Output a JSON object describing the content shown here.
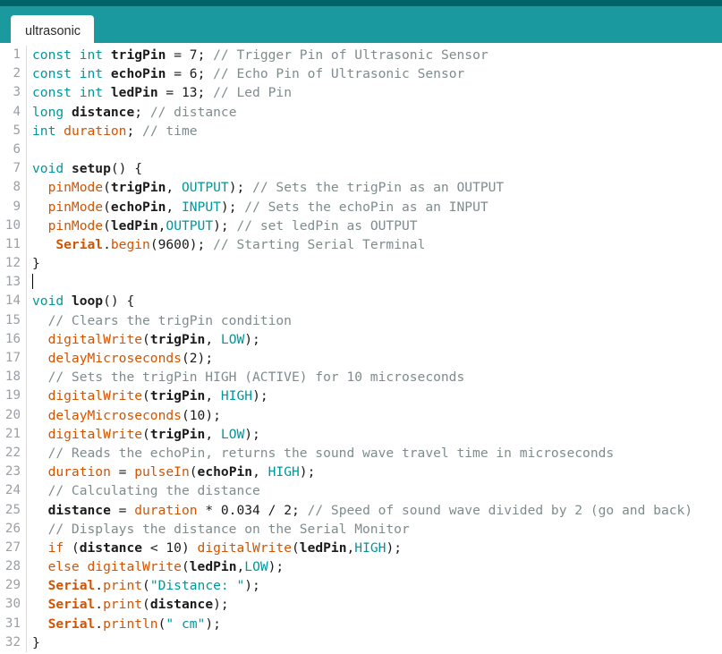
{
  "window": {
    "accent_color": "#1a9a9e",
    "accent_dark_color": "#006468",
    "background_color": "#ffffff"
  },
  "tabs": [
    {
      "label": "ultrasonic",
      "active": true
    }
  ],
  "editor": {
    "language": "arduino",
    "cursor_line": 13,
    "total_lines": 32,
    "colors": {
      "keyword": "#00979c",
      "function": "#d35400",
      "variable": "#d35400",
      "comment": "#7e8c8d",
      "string": "#00979c",
      "identifier": "#1b1b1b",
      "gutter_text": "#9aa0a6"
    },
    "lines": [
      {
        "n": "1",
        "tokens": [
          {
            "t": "kw",
            "v": "const"
          },
          {
            "t": "plain",
            "v": " "
          },
          {
            "t": "kw",
            "v": "int"
          },
          {
            "t": "plain",
            "v": " "
          },
          {
            "t": "id",
            "v": "trigPin"
          },
          {
            "t": "plain",
            "v": " = "
          },
          {
            "t": "num",
            "v": "7"
          },
          {
            "t": "plain",
            "v": "; "
          },
          {
            "t": "com",
            "v": "// Trigger Pin of Ultrasonic Sensor"
          }
        ]
      },
      {
        "n": "2",
        "tokens": [
          {
            "t": "kw",
            "v": "const"
          },
          {
            "t": "plain",
            "v": " "
          },
          {
            "t": "kw",
            "v": "int"
          },
          {
            "t": "plain",
            "v": " "
          },
          {
            "t": "id",
            "v": "echoPin"
          },
          {
            "t": "plain",
            "v": " = "
          },
          {
            "t": "num",
            "v": "6"
          },
          {
            "t": "plain",
            "v": "; "
          },
          {
            "t": "com",
            "v": "// Echo Pin of Ultrasonic Sensor"
          }
        ]
      },
      {
        "n": "3",
        "tokens": [
          {
            "t": "kw",
            "v": "const"
          },
          {
            "t": "plain",
            "v": " "
          },
          {
            "t": "kw",
            "v": "int"
          },
          {
            "t": "plain",
            "v": " "
          },
          {
            "t": "id",
            "v": "ledPin"
          },
          {
            "t": "plain",
            "v": " = "
          },
          {
            "t": "num",
            "v": "13"
          },
          {
            "t": "plain",
            "v": "; "
          },
          {
            "t": "com",
            "v": "// Led Pin"
          }
        ]
      },
      {
        "n": "4",
        "tokens": [
          {
            "t": "kw",
            "v": "long"
          },
          {
            "t": "plain",
            "v": " "
          },
          {
            "t": "id",
            "v": "distance"
          },
          {
            "t": "plain",
            "v": "; "
          },
          {
            "t": "com",
            "v": "// distance"
          }
        ]
      },
      {
        "n": "5",
        "tokens": [
          {
            "t": "kw",
            "v": "int"
          },
          {
            "t": "plain",
            "v": " "
          },
          {
            "t": "var",
            "v": "duration"
          },
          {
            "t": "plain",
            "v": "; "
          },
          {
            "t": "com",
            "v": "// time"
          }
        ]
      },
      {
        "n": "6",
        "tokens": []
      },
      {
        "n": "7",
        "tokens": [
          {
            "t": "kw",
            "v": "void"
          },
          {
            "t": "plain",
            "v": " "
          },
          {
            "t": "id",
            "v": "setup"
          },
          {
            "t": "plain",
            "v": "() {"
          }
        ]
      },
      {
        "n": "8",
        "tokens": [
          {
            "t": "plain",
            "v": "  "
          },
          {
            "t": "fn",
            "v": "pinMode"
          },
          {
            "t": "plain",
            "v": "("
          },
          {
            "t": "id",
            "v": "trigPin"
          },
          {
            "t": "plain",
            "v": ", "
          },
          {
            "t": "const",
            "v": "OUTPUT"
          },
          {
            "t": "plain",
            "v": "); "
          },
          {
            "t": "com",
            "v": "// Sets the trigPin as an OUTPUT"
          }
        ]
      },
      {
        "n": "9",
        "tokens": [
          {
            "t": "plain",
            "v": "  "
          },
          {
            "t": "fn",
            "v": "pinMode"
          },
          {
            "t": "plain",
            "v": "("
          },
          {
            "t": "id",
            "v": "echoPin"
          },
          {
            "t": "plain",
            "v": ", "
          },
          {
            "t": "const",
            "v": "INPUT"
          },
          {
            "t": "plain",
            "v": "); "
          },
          {
            "t": "com",
            "v": "// Sets the echoPin as an INPUT"
          }
        ]
      },
      {
        "n": "10",
        "tokens": [
          {
            "t": "plain",
            "v": "  "
          },
          {
            "t": "fn",
            "v": "pinMode"
          },
          {
            "t": "plain",
            "v": "("
          },
          {
            "t": "id",
            "v": "ledPin"
          },
          {
            "t": "plain",
            "v": ","
          },
          {
            "t": "const",
            "v": "OUTPUT"
          },
          {
            "t": "plain",
            "v": "); "
          },
          {
            "t": "com",
            "v": "// set ledPin as OUTPUT"
          }
        ]
      },
      {
        "n": "11",
        "tokens": [
          {
            "t": "plain",
            "v": "   "
          },
          {
            "t": "obj",
            "v": "Serial"
          },
          {
            "t": "plain",
            "v": "."
          },
          {
            "t": "fn",
            "v": "begin"
          },
          {
            "t": "plain",
            "v": "("
          },
          {
            "t": "num",
            "v": "9600"
          },
          {
            "t": "plain",
            "v": "); "
          },
          {
            "t": "com",
            "v": "// Starting Serial Terminal"
          }
        ]
      },
      {
        "n": "12",
        "tokens": [
          {
            "t": "plain",
            "v": "}"
          }
        ]
      },
      {
        "n": "13",
        "tokens": [],
        "cursor": true
      },
      {
        "n": "14",
        "tokens": [
          {
            "t": "kw",
            "v": "void"
          },
          {
            "t": "plain",
            "v": " "
          },
          {
            "t": "id",
            "v": "loop"
          },
          {
            "t": "plain",
            "v": "() {"
          }
        ]
      },
      {
        "n": "15",
        "tokens": [
          {
            "t": "plain",
            "v": "  "
          },
          {
            "t": "com",
            "v": "// Clears the trigPin condition"
          }
        ]
      },
      {
        "n": "16",
        "tokens": [
          {
            "t": "plain",
            "v": "  "
          },
          {
            "t": "fn",
            "v": "digitalWrite"
          },
          {
            "t": "plain",
            "v": "("
          },
          {
            "t": "id",
            "v": "trigPin"
          },
          {
            "t": "plain",
            "v": ", "
          },
          {
            "t": "const",
            "v": "LOW"
          },
          {
            "t": "plain",
            "v": ");"
          }
        ]
      },
      {
        "n": "17",
        "tokens": [
          {
            "t": "plain",
            "v": "  "
          },
          {
            "t": "fn",
            "v": "delayMicroseconds"
          },
          {
            "t": "plain",
            "v": "("
          },
          {
            "t": "num",
            "v": "2"
          },
          {
            "t": "plain",
            "v": ");"
          }
        ]
      },
      {
        "n": "18",
        "tokens": [
          {
            "t": "plain",
            "v": "  "
          },
          {
            "t": "com",
            "v": "// Sets the trigPin HIGH (ACTIVE) for 10 microseconds"
          }
        ]
      },
      {
        "n": "19",
        "tokens": [
          {
            "t": "plain",
            "v": "  "
          },
          {
            "t": "fn",
            "v": "digitalWrite"
          },
          {
            "t": "plain",
            "v": "("
          },
          {
            "t": "id",
            "v": "trigPin"
          },
          {
            "t": "plain",
            "v": ", "
          },
          {
            "t": "const",
            "v": "HIGH"
          },
          {
            "t": "plain",
            "v": ");"
          }
        ]
      },
      {
        "n": "20",
        "tokens": [
          {
            "t": "plain",
            "v": "  "
          },
          {
            "t": "fn",
            "v": "delayMicroseconds"
          },
          {
            "t": "plain",
            "v": "("
          },
          {
            "t": "num",
            "v": "10"
          },
          {
            "t": "plain",
            "v": ");"
          }
        ]
      },
      {
        "n": "21",
        "tokens": [
          {
            "t": "plain",
            "v": "  "
          },
          {
            "t": "fn",
            "v": "digitalWrite"
          },
          {
            "t": "plain",
            "v": "("
          },
          {
            "t": "id",
            "v": "trigPin"
          },
          {
            "t": "plain",
            "v": ", "
          },
          {
            "t": "const",
            "v": "LOW"
          },
          {
            "t": "plain",
            "v": ");"
          }
        ]
      },
      {
        "n": "22",
        "tokens": [
          {
            "t": "plain",
            "v": "  "
          },
          {
            "t": "com",
            "v": "// Reads the echoPin, returns the sound wave travel time in microseconds"
          }
        ]
      },
      {
        "n": "23",
        "tokens": [
          {
            "t": "plain",
            "v": "  "
          },
          {
            "t": "var",
            "v": "duration"
          },
          {
            "t": "plain",
            "v": " = "
          },
          {
            "t": "fn",
            "v": "pulseIn"
          },
          {
            "t": "plain",
            "v": "("
          },
          {
            "t": "id",
            "v": "echoPin"
          },
          {
            "t": "plain",
            "v": ", "
          },
          {
            "t": "const",
            "v": "HIGH"
          },
          {
            "t": "plain",
            "v": ");"
          }
        ]
      },
      {
        "n": "24",
        "tokens": [
          {
            "t": "plain",
            "v": "  "
          },
          {
            "t": "com",
            "v": "// Calculating the distance"
          }
        ]
      },
      {
        "n": "25",
        "tokens": [
          {
            "t": "plain",
            "v": "  "
          },
          {
            "t": "id",
            "v": "distance"
          },
          {
            "t": "plain",
            "v": " = "
          },
          {
            "t": "var",
            "v": "duration"
          },
          {
            "t": "plain",
            "v": " * "
          },
          {
            "t": "num",
            "v": "0.034"
          },
          {
            "t": "plain",
            "v": " / "
          },
          {
            "t": "num",
            "v": "2"
          },
          {
            "t": "plain",
            "v": "; "
          },
          {
            "t": "com",
            "v": "// Speed of sound wave divided by 2 (go and back)"
          }
        ]
      },
      {
        "n": "26",
        "tokens": [
          {
            "t": "plain",
            "v": "  "
          },
          {
            "t": "com",
            "v": "// Displays the distance on the Serial Monitor"
          }
        ]
      },
      {
        "n": "27",
        "tokens": [
          {
            "t": "plain",
            "v": "  "
          },
          {
            "t": "fn",
            "v": "if"
          },
          {
            "t": "plain",
            "v": " ("
          },
          {
            "t": "id",
            "v": "distance"
          },
          {
            "t": "plain",
            "v": " < "
          },
          {
            "t": "num",
            "v": "10"
          },
          {
            "t": "plain",
            "v": ") "
          },
          {
            "t": "fn",
            "v": "digitalWrite"
          },
          {
            "t": "plain",
            "v": "("
          },
          {
            "t": "id",
            "v": "ledPin"
          },
          {
            "t": "plain",
            "v": ","
          },
          {
            "t": "const",
            "v": "HIGH"
          },
          {
            "t": "plain",
            "v": ");"
          }
        ]
      },
      {
        "n": "28",
        "tokens": [
          {
            "t": "plain",
            "v": "  "
          },
          {
            "t": "fn",
            "v": "else"
          },
          {
            "t": "plain",
            "v": " "
          },
          {
            "t": "fn",
            "v": "digitalWrite"
          },
          {
            "t": "plain",
            "v": "("
          },
          {
            "t": "id",
            "v": "ledPin"
          },
          {
            "t": "plain",
            "v": ","
          },
          {
            "t": "const",
            "v": "LOW"
          },
          {
            "t": "plain",
            "v": ");"
          }
        ]
      },
      {
        "n": "29",
        "tokens": [
          {
            "t": "plain",
            "v": "  "
          },
          {
            "t": "obj",
            "v": "Serial"
          },
          {
            "t": "plain",
            "v": "."
          },
          {
            "t": "fn",
            "v": "print"
          },
          {
            "t": "plain",
            "v": "("
          },
          {
            "t": "str",
            "v": "\"Distance: \""
          },
          {
            "t": "plain",
            "v": ");"
          }
        ]
      },
      {
        "n": "30",
        "tokens": [
          {
            "t": "plain",
            "v": "  "
          },
          {
            "t": "obj",
            "v": "Serial"
          },
          {
            "t": "plain",
            "v": "."
          },
          {
            "t": "fn",
            "v": "print"
          },
          {
            "t": "plain",
            "v": "("
          },
          {
            "t": "id",
            "v": "distance"
          },
          {
            "t": "plain",
            "v": ");"
          }
        ]
      },
      {
        "n": "31",
        "tokens": [
          {
            "t": "plain",
            "v": "  "
          },
          {
            "t": "obj",
            "v": "Serial"
          },
          {
            "t": "plain",
            "v": "."
          },
          {
            "t": "fn",
            "v": "println"
          },
          {
            "t": "plain",
            "v": "("
          },
          {
            "t": "str",
            "v": "\" cm\""
          },
          {
            "t": "plain",
            "v": ");"
          }
        ]
      },
      {
        "n": "32",
        "tokens": [
          {
            "t": "plain",
            "v": "}"
          }
        ]
      }
    ]
  }
}
